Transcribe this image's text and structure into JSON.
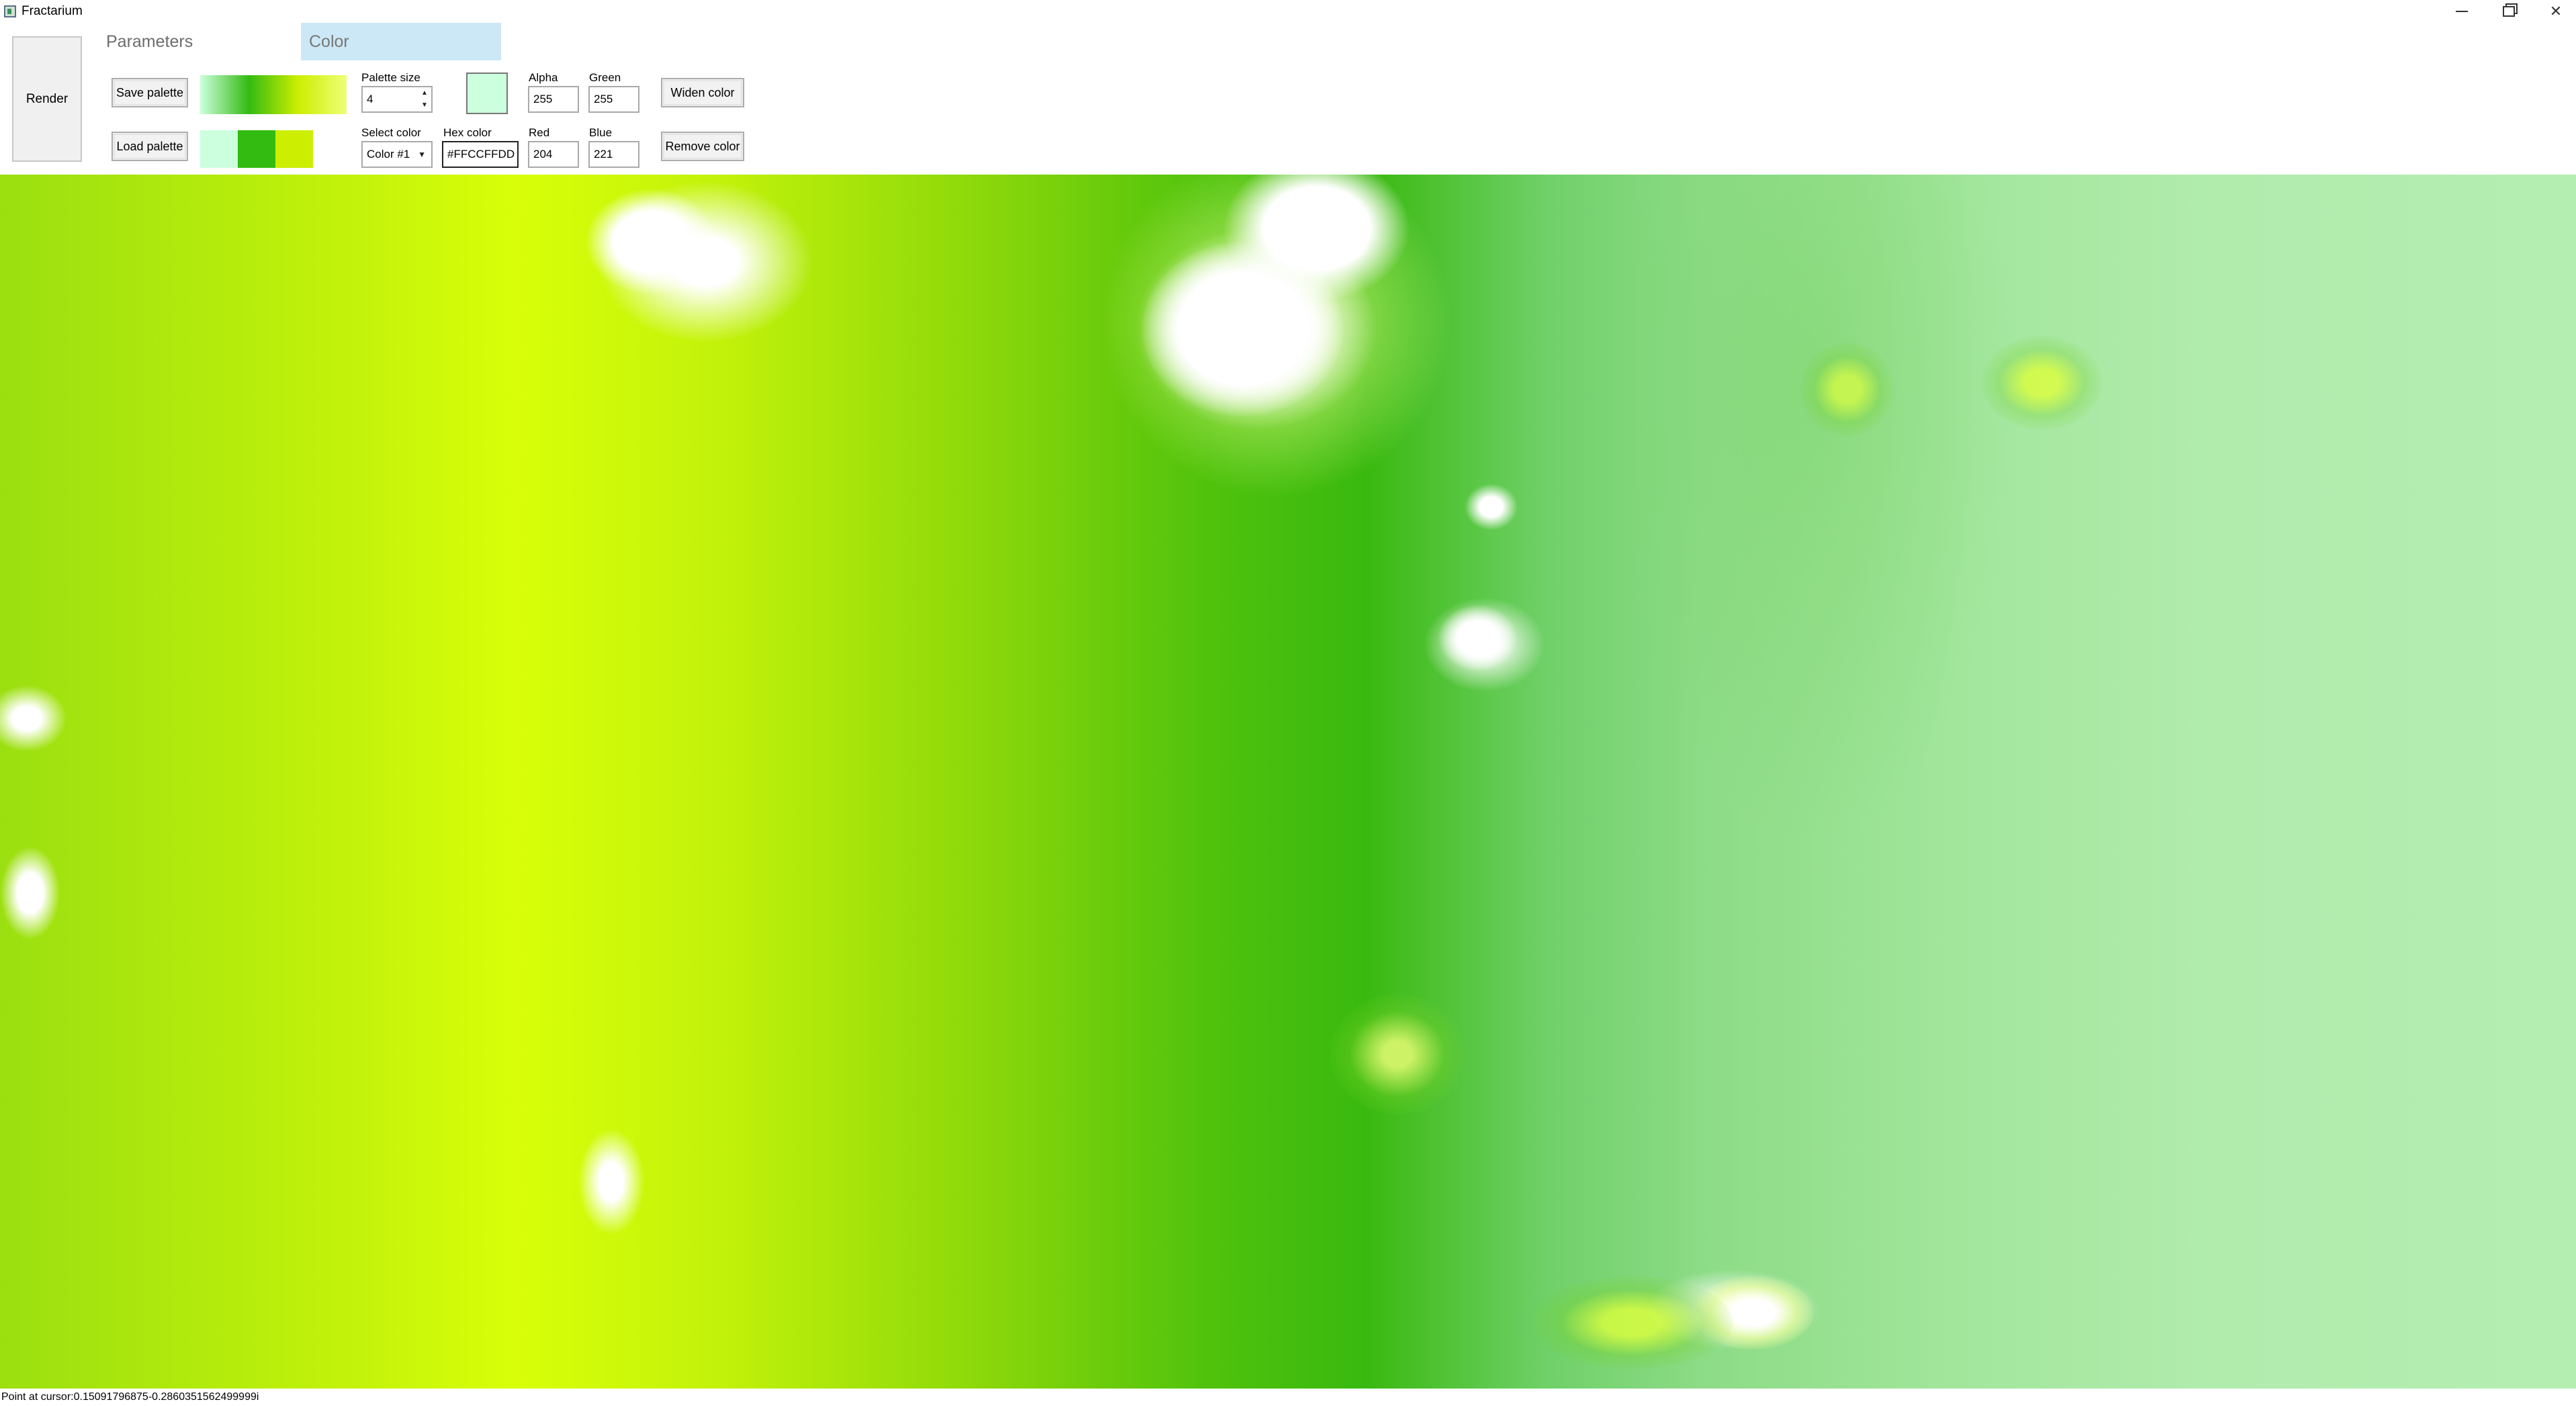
{
  "window": {
    "title": "Fractarium"
  },
  "toolbar": {
    "render_label": "Render",
    "tabs": [
      {
        "label": "Parameters",
        "selected": false
      },
      {
        "label": "Color",
        "selected": true
      }
    ],
    "save_palette_label": "Save palette",
    "load_palette_label": "Load palette",
    "widen_color_label": "Widen color",
    "remove_color_label": "Remove color"
  },
  "palette": {
    "gradient_colors": [
      "#CCFFDD",
      "#33BB11",
      "#CCEE00",
      "#EEFF77"
    ],
    "swatches": [
      "#CCFFDD",
      "#33BB11",
      "#CCEE00"
    ],
    "size_label": "Palette size",
    "size_value": "4",
    "select_label": "Select color",
    "select_value": "Color #1",
    "hex_label": "Hex color",
    "hex_value": "#FFCCFFDD",
    "preview_color": "#CCFFDD"
  },
  "channels": {
    "alpha_label": "Alpha",
    "alpha_value": "255",
    "green_label": "Green",
    "green_value": "255",
    "red_label": "Red",
    "red_value": "204",
    "blue_label": "Blue",
    "blue_value": "221"
  },
  "status": {
    "text": "Point at cursor:0.15091796875-0.2860351562499999i"
  }
}
